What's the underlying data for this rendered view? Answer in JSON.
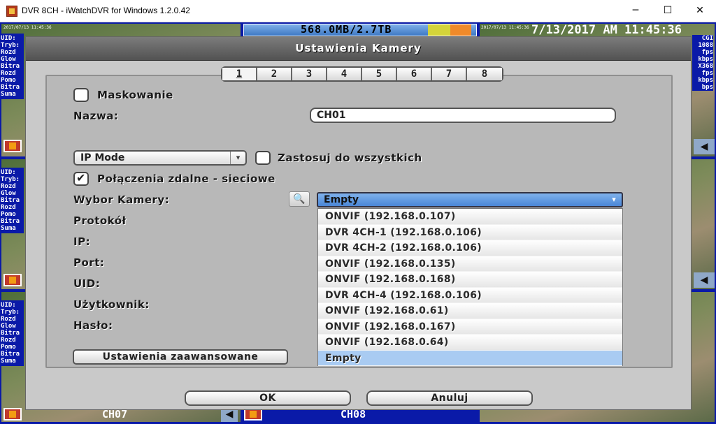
{
  "window": {
    "title": "DVR 8CH - iWatchDVR for Windows 1.2.0.42",
    "minimize": "─",
    "maximize": "☐",
    "close": "✕"
  },
  "dvr": {
    "storage": "568.0MB/2.7TB",
    "datetime": "7/13/2017 AM 11:45:36",
    "timestamp_small": "2017/07/13 11:45:36",
    "timestamp_small_top": "2017/07/13 11:45:36",
    "left_overlay_lines": [
      "UID:",
      "Tryb:",
      "Rozd",
      "Glow",
      "Bitra",
      "Rozd",
      "Pomo",
      "Bitra",
      "Suma"
    ],
    "right_overlay_lines": [
      "",
      "CGI",
      "1088",
      "fps",
      "kbps",
      "X368",
      "fps",
      "kbps",
      "bps"
    ],
    "channel_labels": [
      "CH07",
      "CH08"
    ]
  },
  "dialog": {
    "title": "Ustawienia Kamery",
    "tabs": [
      "1",
      "2",
      "3",
      "4",
      "5",
      "6",
      "7",
      "8"
    ],
    "active_tab": "1",
    "masking_label": "Maskowanie",
    "masking_checked": false,
    "name_label": "Nazwa:",
    "name_value": "CH01",
    "mode_select": "IP Mode",
    "apply_all_label": "Zastosuj do wszystkich",
    "apply_all_checked": false,
    "remote_label": "Połączenia zdalne - sieciowe",
    "remote_checked": true,
    "camera_choice_label": "Wybor Kamery:",
    "camera_selected": "Empty",
    "camera_options": [
      "ONVIF (192.168.0.107)",
      "DVR 4CH-1 (192.168.0.106)",
      "DVR 4CH-2 (192.168.0.106)",
      "ONVIF (192.168.0.135)",
      "ONVIF (192.168.0.168)",
      "DVR 4CH-4 (192.168.0.106)",
      "ONVIF (192.168.0.61)",
      "ONVIF (192.168.0.167)",
      "ONVIF (192.168.0.64)",
      "Empty"
    ],
    "protocol_label": "Protokół",
    "ip_label": "IP:",
    "port_label": "Port:",
    "uid_label": "UID:",
    "user_label": "Użytkownik:",
    "password_label": "Hasło:",
    "advanced_button": "Ustawienia zaawansowane",
    "ok_button": "OK",
    "cancel_button": "Anuluj"
  },
  "colors": {
    "dvr_background": "#0a1aa8",
    "dialog_header": "#5e5e5e",
    "dialog_body": "#c9c9c9",
    "selected_option": "#a9cbf2",
    "select_highlight": "#5a92dc"
  }
}
